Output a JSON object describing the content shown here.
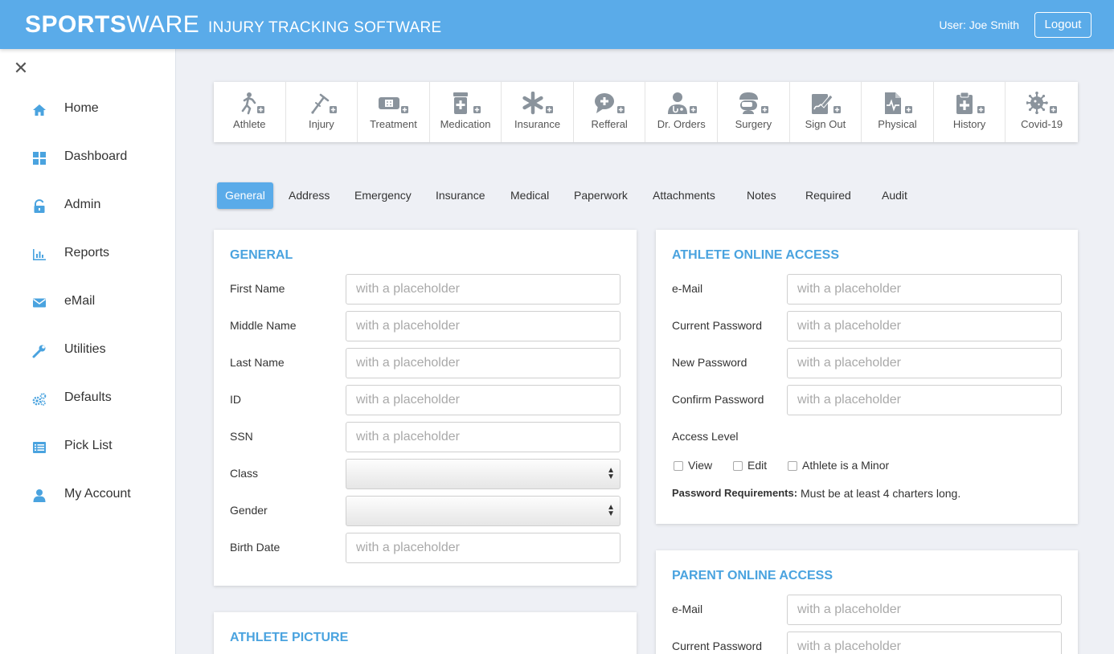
{
  "header": {
    "logo_bold": "SPORTS",
    "logo_regular": "WARE",
    "tagline": "INJURY TRACKING SOFTWARE",
    "user_label": "User: Joe Smith",
    "logout_label": "Logout",
    "bg_color": "#5aabe9"
  },
  "sidebar": {
    "close_label": "✕",
    "items": [
      {
        "label": "Home",
        "icon": "home-icon"
      },
      {
        "label": "Dashboard",
        "icon": "dashboard-icon"
      },
      {
        "label": "Admin",
        "icon": "lock-icon"
      },
      {
        "label": "Reports",
        "icon": "bar-chart-icon"
      },
      {
        "label": "eMail",
        "icon": "envelope-icon"
      },
      {
        "label": "Utilities",
        "icon": "wrench-icon"
      },
      {
        "label": "Defaults",
        "icon": "gears-icon"
      },
      {
        "label": "Pick List",
        "icon": "list-icon"
      },
      {
        "label": "My Account",
        "icon": "user-icon"
      }
    ]
  },
  "toolbar": {
    "items": [
      {
        "label": "Athlete",
        "icon": "runner-icon"
      },
      {
        "label": "Injury",
        "icon": "crutch-icon"
      },
      {
        "label": "Treatment",
        "icon": "bandage-icon"
      },
      {
        "label": "Medication",
        "icon": "pill-bottle-icon"
      },
      {
        "label": "Insurance",
        "icon": "asterisk-icon"
      },
      {
        "label": "Refferal",
        "icon": "speech-bubble-icon"
      },
      {
        "label": "Dr. Orders",
        "icon": "doctor-icon"
      },
      {
        "label": "Surgery",
        "icon": "surgeon-icon"
      },
      {
        "label": "Sign Out",
        "icon": "signature-icon"
      },
      {
        "label": "Physical",
        "icon": "pulse-document-icon"
      },
      {
        "label": "History",
        "icon": "clipboard-icon"
      },
      {
        "label": "Covid-19",
        "icon": "virus-icon"
      }
    ]
  },
  "tabs": [
    "General",
    "Address",
    "Emergency",
    "Insurance",
    "Medical",
    "Paperwork",
    "Attachments",
    "Notes",
    "Required",
    "Audit"
  ],
  "general": {
    "title": "GENERAL",
    "fields": {
      "first_name": {
        "label": "First Name",
        "placeholder": "with a placeholder"
      },
      "middle_name": {
        "label": "Middle Name",
        "placeholder": "with a placeholder"
      },
      "last_name": {
        "label": "Last Name",
        "placeholder": "with a placeholder"
      },
      "id": {
        "label": "ID",
        "placeholder": "with a placeholder"
      },
      "ssn": {
        "label": "SSN",
        "placeholder": "with a placeholder"
      },
      "class": {
        "label": "Class"
      },
      "gender": {
        "label": "Gender"
      },
      "birth_date": {
        "label": "Birth Date",
        "placeholder": "with a placeholder"
      }
    }
  },
  "athlete_picture": {
    "title": "ATHLETE PICTURE"
  },
  "athlete_access": {
    "title": "ATHLETE ONLINE ACCESS",
    "fields": {
      "email": {
        "label": "e-Mail",
        "placeholder": "with a placeholder"
      },
      "current_password": {
        "label": "Current Password",
        "placeholder": "with a placeholder"
      },
      "new_password": {
        "label": "New Password",
        "placeholder": "with a placeholder"
      },
      "confirm_password": {
        "label": "Confirm Password",
        "placeholder": "with a placeholder"
      }
    },
    "access_level_label": "Access Level",
    "checks": {
      "view": "View",
      "edit": "Edit",
      "minor": "Athlete is a Minor"
    },
    "req_label": "Password Requirements:",
    "req_text": "Must be at least 4 charters long."
  },
  "parent_access": {
    "title": "PARENT ONLINE ACCESS",
    "fields": {
      "email": {
        "label": "e-Mail",
        "placeholder": "with a placeholder"
      },
      "current_password": {
        "label": "Current Password",
        "placeholder": "with a placeholder"
      }
    }
  },
  "colors": {
    "accent": "#5aabe9",
    "title": "#4aa3df",
    "icon": "#8a939c",
    "page_bg": "#eef0f5"
  }
}
